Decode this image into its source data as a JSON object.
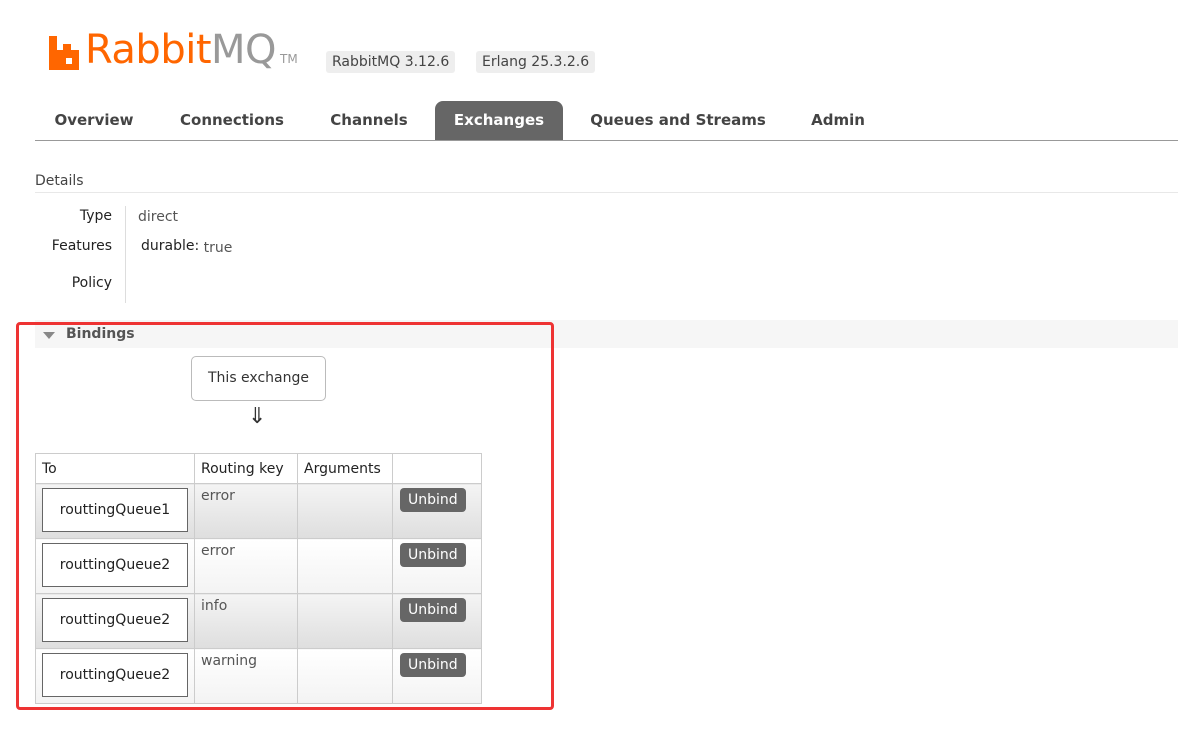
{
  "header": {
    "logo_rabbit": "Rabbit",
    "logo_mq": "MQ",
    "logo_tm": "TM",
    "rabbitmq_version": "RabbitMQ 3.12.6",
    "erlang_version": "Erlang 25.3.2.6"
  },
  "tabs": [
    {
      "label": "Overview"
    },
    {
      "label": "Connections"
    },
    {
      "label": "Channels"
    },
    {
      "label": "Exchanges",
      "active": true
    },
    {
      "label": "Queues and Streams"
    },
    {
      "label": "Admin"
    }
  ],
  "details": {
    "title": "Details",
    "type_label": "Type",
    "type_value": "direct",
    "features_label": "Features",
    "durable_key": "durable:",
    "durable_value": "true",
    "policy_label": "Policy"
  },
  "bindings": {
    "title": "Bindings",
    "exchange_box": "This exchange",
    "arrow": "⇓",
    "columns": {
      "to": "To",
      "routing_key": "Routing key",
      "arguments": "Arguments"
    },
    "rows": [
      {
        "queue": "routtingQueue1",
        "routing_key": "error",
        "arguments": "",
        "action": "Unbind"
      },
      {
        "queue": "routtingQueue2",
        "routing_key": "error",
        "arguments": "",
        "action": "Unbind"
      },
      {
        "queue": "routtingQueue2",
        "routing_key": "info",
        "arguments": "",
        "action": "Unbind"
      },
      {
        "queue": "routtingQueue2",
        "routing_key": "warning",
        "arguments": "",
        "action": "Unbind"
      }
    ]
  },
  "colors": {
    "brand": "#ff6600",
    "tab_active": "#666666",
    "highlight": "#ee3333"
  },
  "icons": {
    "logo": "rabbitmq-logo-icon",
    "collapse": "triangle-down-icon",
    "flow": "double-arrow-down-icon"
  }
}
